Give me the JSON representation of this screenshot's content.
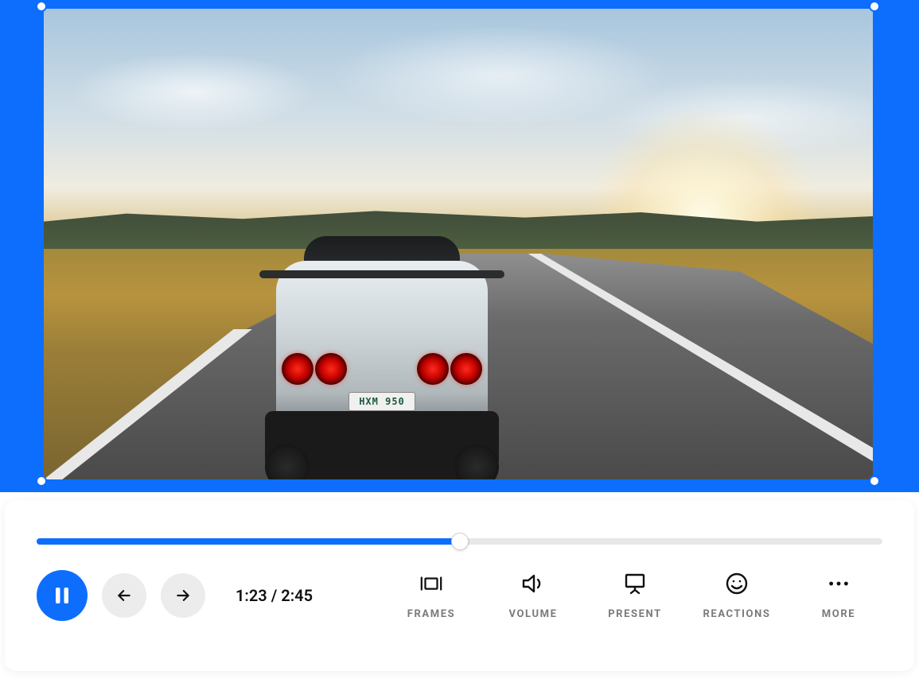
{
  "video": {
    "license_plate": "HXM 950"
  },
  "player": {
    "progress_percent": 50,
    "current_time": "1:23",
    "duration": "2:45",
    "time_display": "1:23 / 2:45"
  },
  "controls": {
    "pause_label": "Pause",
    "prev_label": "Previous",
    "next_label": "Next",
    "actions": [
      {
        "key": "frames",
        "label": "FRAMES"
      },
      {
        "key": "volume",
        "label": "VOLUME"
      },
      {
        "key": "present",
        "label": "PRESENT"
      },
      {
        "key": "reactions",
        "label": "REACTIONS"
      },
      {
        "key": "more",
        "label": "MORE"
      }
    ]
  }
}
